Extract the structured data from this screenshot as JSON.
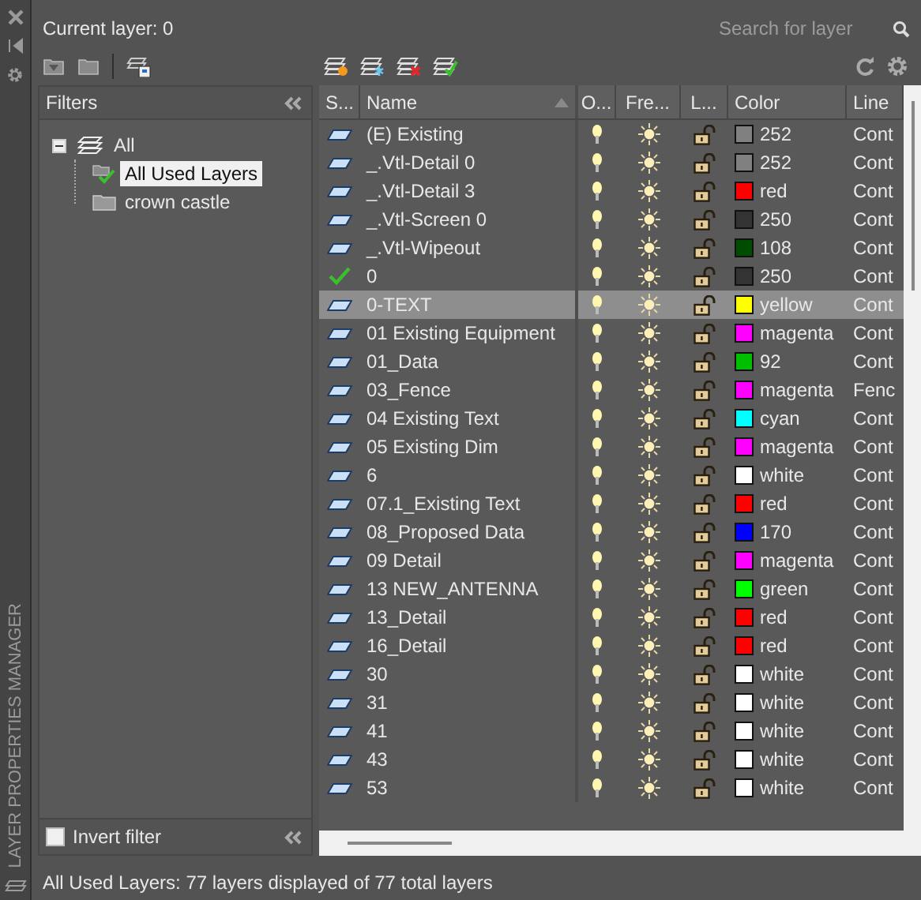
{
  "palette_title": "LAYER PROPERTIES MANAGER",
  "current_layer": "Current layer: 0",
  "search": {
    "placeholder": "Search for layer"
  },
  "filters": {
    "title": "Filters",
    "tree": [
      {
        "label": "All",
        "expanded": true,
        "children": [
          {
            "label": "All Used Layers",
            "selected": true,
            "kind": "used"
          },
          {
            "label": "crown castle",
            "selected": false,
            "kind": "folder"
          }
        ]
      }
    ],
    "invert_filter": {
      "label": "Invert filter",
      "checked": false
    }
  },
  "table": {
    "columns": [
      "S...",
      "Name",
      "O...",
      "Fre...",
      "L...",
      "Color",
      "Line"
    ],
    "rows": [
      {
        "kind": "layer",
        "name": "(E) Existing",
        "on": true,
        "frozen": false,
        "locked": false,
        "color": "#808080",
        "color_name": "252",
        "linetype": "Cont",
        "selected": false
      },
      {
        "kind": "layer",
        "name": "_.Vtl-Detail 0",
        "on": true,
        "frozen": false,
        "locked": false,
        "color": "#808080",
        "color_name": "252",
        "linetype": "Cont",
        "selected": false
      },
      {
        "kind": "layer",
        "name": "_.Vtl-Detail 3",
        "on": true,
        "frozen": false,
        "locked": false,
        "color": "#ff0000",
        "color_name": "red",
        "linetype": "Cont",
        "selected": false
      },
      {
        "kind": "layer",
        "name": "_.Vtl-Screen 0",
        "on": true,
        "frozen": false,
        "locked": false,
        "color": "#333333",
        "color_name": "250",
        "linetype": "Cont",
        "selected": false
      },
      {
        "kind": "layer",
        "name": "_.Vtl-Wipeout",
        "on": true,
        "frozen": false,
        "locked": false,
        "color": "#004c00",
        "color_name": "108",
        "linetype": "Cont",
        "selected": false
      },
      {
        "kind": "current",
        "name": "0",
        "on": true,
        "frozen": false,
        "locked": false,
        "color": "#333333",
        "color_name": "250",
        "linetype": "Cont",
        "selected": false
      },
      {
        "kind": "layer",
        "name": "0-TEXT",
        "on": true,
        "frozen": false,
        "locked": false,
        "color": "#ffff00",
        "color_name": "yellow",
        "linetype": "Cont",
        "selected": true
      },
      {
        "kind": "layer",
        "name": "01 Existing Equipment",
        "on": true,
        "frozen": false,
        "locked": false,
        "color": "#ff00ff",
        "color_name": "magenta",
        "linetype": "Cont",
        "selected": false
      },
      {
        "kind": "layer",
        "name": "01_Data",
        "on": true,
        "frozen": false,
        "locked": false,
        "color": "#00bf00",
        "color_name": "92",
        "linetype": "Cont",
        "selected": false
      },
      {
        "kind": "layer",
        "name": "03_Fence",
        "on": true,
        "frozen": false,
        "locked": false,
        "color": "#ff00ff",
        "color_name": "magenta",
        "linetype": "Fenc",
        "selected": false
      },
      {
        "kind": "layer",
        "name": "04 Existing Text",
        "on": true,
        "frozen": false,
        "locked": false,
        "color": "#00ffff",
        "color_name": "cyan",
        "linetype": "Cont",
        "selected": false
      },
      {
        "kind": "layer",
        "name": "05 Existing Dim",
        "on": true,
        "frozen": false,
        "locked": false,
        "color": "#ff00ff",
        "color_name": "magenta",
        "linetype": "Cont",
        "selected": false
      },
      {
        "kind": "layer",
        "name": "6",
        "on": true,
        "frozen": false,
        "locked": false,
        "color": "#ffffff",
        "color_name": "white",
        "linetype": "Cont",
        "selected": false
      },
      {
        "kind": "layer",
        "name": "07.1_Existing Text",
        "on": true,
        "frozen": false,
        "locked": false,
        "color": "#ff0000",
        "color_name": "red",
        "linetype": "Cont",
        "selected": false
      },
      {
        "kind": "layer",
        "name": "08_Proposed Data",
        "on": true,
        "frozen": false,
        "locked": false,
        "color": "#0000ff",
        "color_name": "170",
        "linetype": "Cont",
        "selected": false
      },
      {
        "kind": "layer",
        "name": "09 Detail",
        "on": true,
        "frozen": false,
        "locked": false,
        "color": "#ff00ff",
        "color_name": "magenta",
        "linetype": "Cont",
        "selected": false
      },
      {
        "kind": "layer",
        "name": "13 NEW_ANTENNA",
        "on": true,
        "frozen": false,
        "locked": false,
        "color": "#00ff00",
        "color_name": "green",
        "linetype": "Cont",
        "selected": false
      },
      {
        "kind": "layer",
        "name": "13_Detail",
        "on": true,
        "frozen": false,
        "locked": false,
        "color": "#ff0000",
        "color_name": "red",
        "linetype": "Cont",
        "selected": false
      },
      {
        "kind": "layer",
        "name": "16_Detail",
        "on": true,
        "frozen": false,
        "locked": false,
        "color": "#ff0000",
        "color_name": "red",
        "linetype": "Cont",
        "selected": false
      },
      {
        "kind": "layer",
        "name": "30",
        "on": true,
        "frozen": false,
        "locked": false,
        "color": "#ffffff",
        "color_name": "white",
        "linetype": "Cont",
        "selected": false
      },
      {
        "kind": "layer",
        "name": "31",
        "on": true,
        "frozen": false,
        "locked": false,
        "color": "#ffffff",
        "color_name": "white",
        "linetype": "Cont",
        "selected": false
      },
      {
        "kind": "layer",
        "name": "41",
        "on": true,
        "frozen": false,
        "locked": false,
        "color": "#ffffff",
        "color_name": "white",
        "linetype": "Cont",
        "selected": false
      },
      {
        "kind": "layer",
        "name": "43",
        "on": true,
        "frozen": false,
        "locked": false,
        "color": "#ffffff",
        "color_name": "white",
        "linetype": "Cont",
        "selected": false
      },
      {
        "kind": "layer",
        "name": "53",
        "on": true,
        "frozen": false,
        "locked": false,
        "color": "#ffffff",
        "color_name": "white",
        "linetype": "Cont",
        "selected": false
      }
    ]
  },
  "status_bar": "All Used Layers: 77 layers displayed of 77 total layers"
}
